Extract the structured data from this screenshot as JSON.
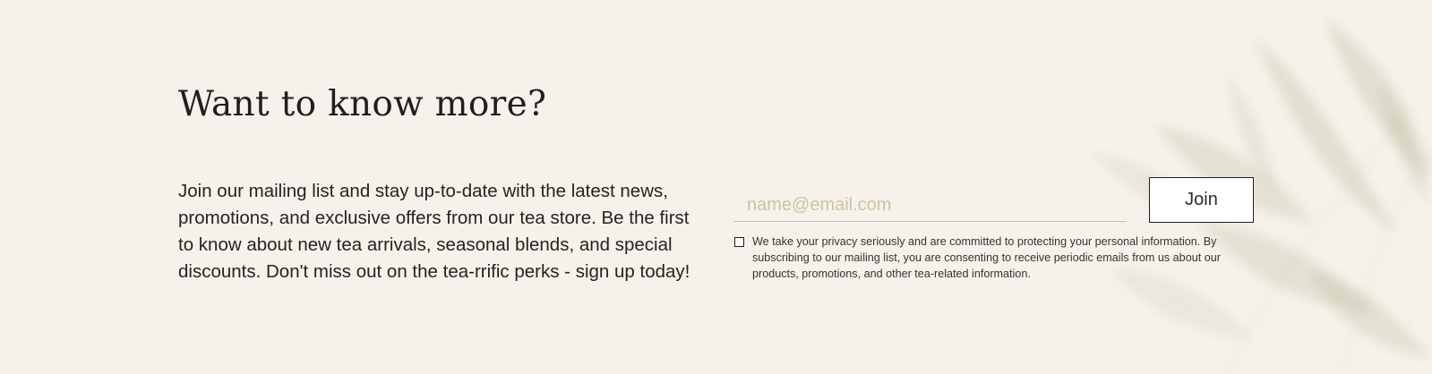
{
  "newsletter": {
    "heading": "Want to know more?",
    "description": "Join our mailing list and stay up-to-date with the latest news, promotions, and exclusive offers from our tea store. Be the first to know about new tea arrivals, seasonal blends, and special discounts. Don't miss out on the tea-rrific perks - sign up today!",
    "email_placeholder": "name@email.com",
    "email_value": "",
    "join_label": "Join",
    "consent_checked": false,
    "consent_text": "We take your privacy seriously and are committed to protecting your personal information. By subscribing to our mailing list, you are consenting to receive periodic emails from us about our products, promotions, and other tea-related information."
  },
  "colors": {
    "background": "#f6f2eb",
    "text": "#1d1d1b",
    "placeholder": "#cdc3a2",
    "underline": "#c9c1a3",
    "leaf_tint": "#b9bda0"
  },
  "decor": {
    "background_image": "tea-leaves-illustration"
  }
}
